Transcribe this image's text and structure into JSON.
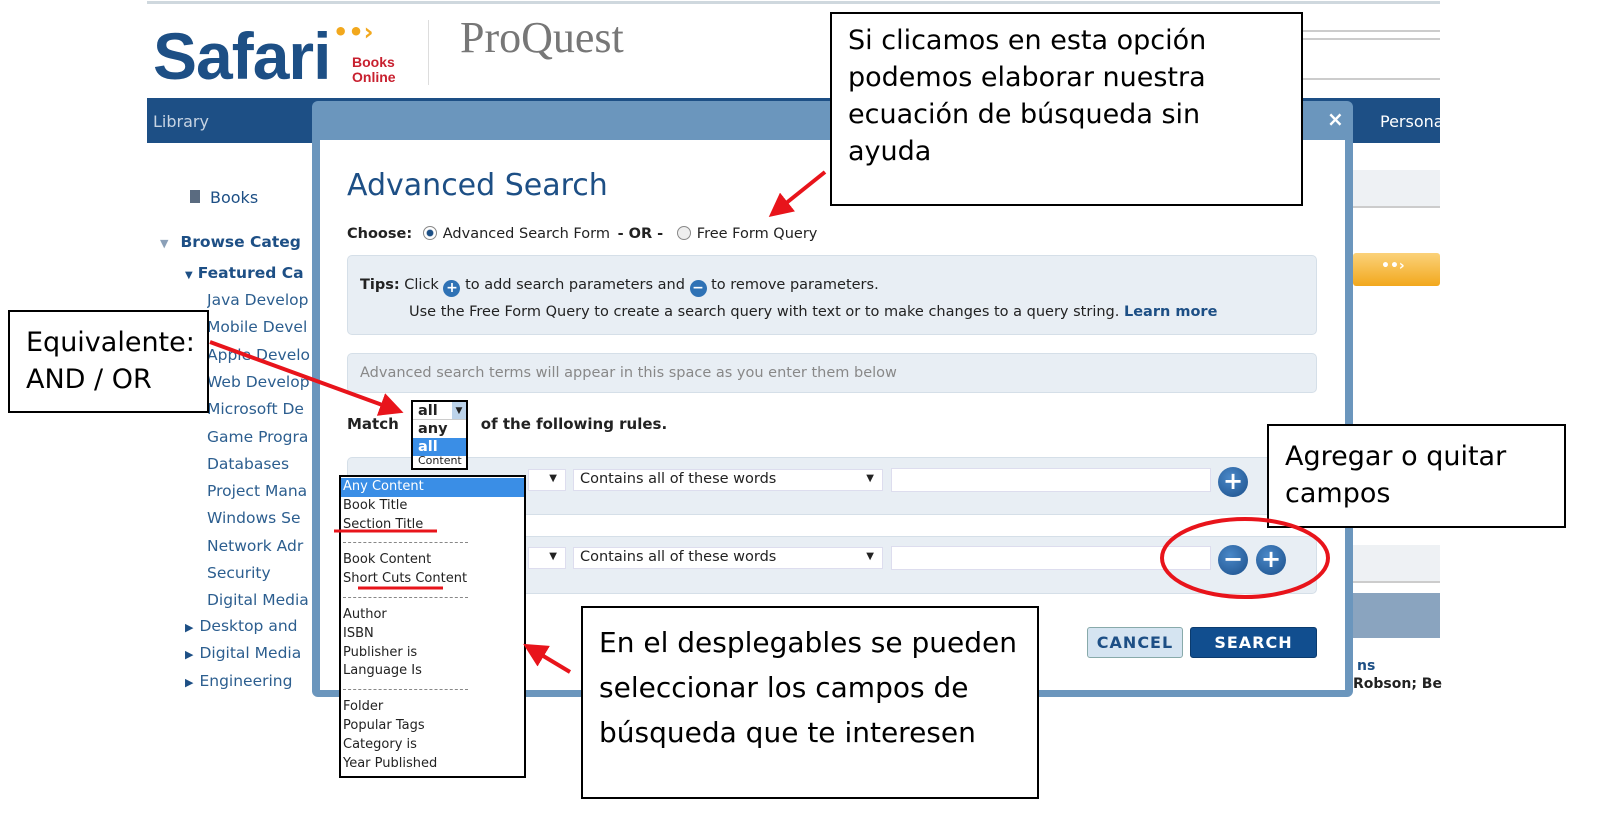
{
  "header": {
    "logo_main": "Safari",
    "logo_sub1": "Books",
    "logo_sub2": "Online",
    "logo_partner": "ProQuest"
  },
  "nav": {
    "library": "Library",
    "personal": "Persona"
  },
  "sidebar": {
    "books": "Books",
    "browse": "Browse Categ",
    "featured": "Featured Ca",
    "items": [
      "Java Develop",
      "Mobile Devel",
      "Apple Develo",
      "Web Develop",
      "Microsoft De",
      "Game Progra",
      "Databases",
      "Project Mana",
      "Windows Se",
      "Network Adr",
      "Security",
      "Digital Media"
    ],
    "collapsed": [
      "Desktop and",
      "Digital Media",
      "Engineering"
    ]
  },
  "right_fragments": {
    "line1": "ns",
    "line2": "Robson; Be"
  },
  "modal": {
    "close": "×",
    "title": "Advanced Search",
    "choose_label": "Choose:",
    "option_form": "Advanced Search Form",
    "or": "- OR -",
    "option_free": "Free Form Query",
    "tips_label": "Tips:",
    "tips_1a": "Click",
    "tips_1b": "to add search parameters and",
    "tips_1c": "to remove parameters.",
    "tips_2": "Use the Free Form Query to create a search query with text or to make changes to a query string.",
    "learn_more": "Learn more",
    "terms_placeholder": "Advanced search terms will appear in this space as you enter them below",
    "match_label": "Match",
    "match_value": "all",
    "match_options": [
      "any",
      "all"
    ],
    "match_suffix": "of the following rules.",
    "rules": [
      {
        "field": "Any Content",
        "operator": "Contains all of these words",
        "value": ""
      },
      {
        "field": "Any Content",
        "operator": "Contains all of these words",
        "value": ""
      }
    ],
    "field_options": [
      [
        "Any Content",
        "Book Title",
        "Section Title"
      ],
      [
        "Book Content",
        "Short Cuts Content"
      ],
      [
        "Author",
        "ISBN",
        "Publisher is",
        "Language Is"
      ],
      [
        "Folder",
        "Popular Tags",
        "Category is",
        "Year Published"
      ]
    ],
    "peek": "Content",
    "cancel": "CANCEL",
    "search": "SEARCH"
  },
  "callouts": {
    "free_form": "Si clicamos en esta opción podemos elaborar nuestra ecuación de búsqueda sin ayuda",
    "and_or": "Equivalente: AND / OR",
    "add_remove": "Agregar o quitar campos",
    "dropdown": "En el desplegables se pueden seleccionar los campos de búsqueda que te interesen"
  },
  "colors": {
    "brand": "#1d4f85",
    "annotation": "#e8141b",
    "highlight": "#3a8ee6",
    "accent": "#f2a81d"
  }
}
